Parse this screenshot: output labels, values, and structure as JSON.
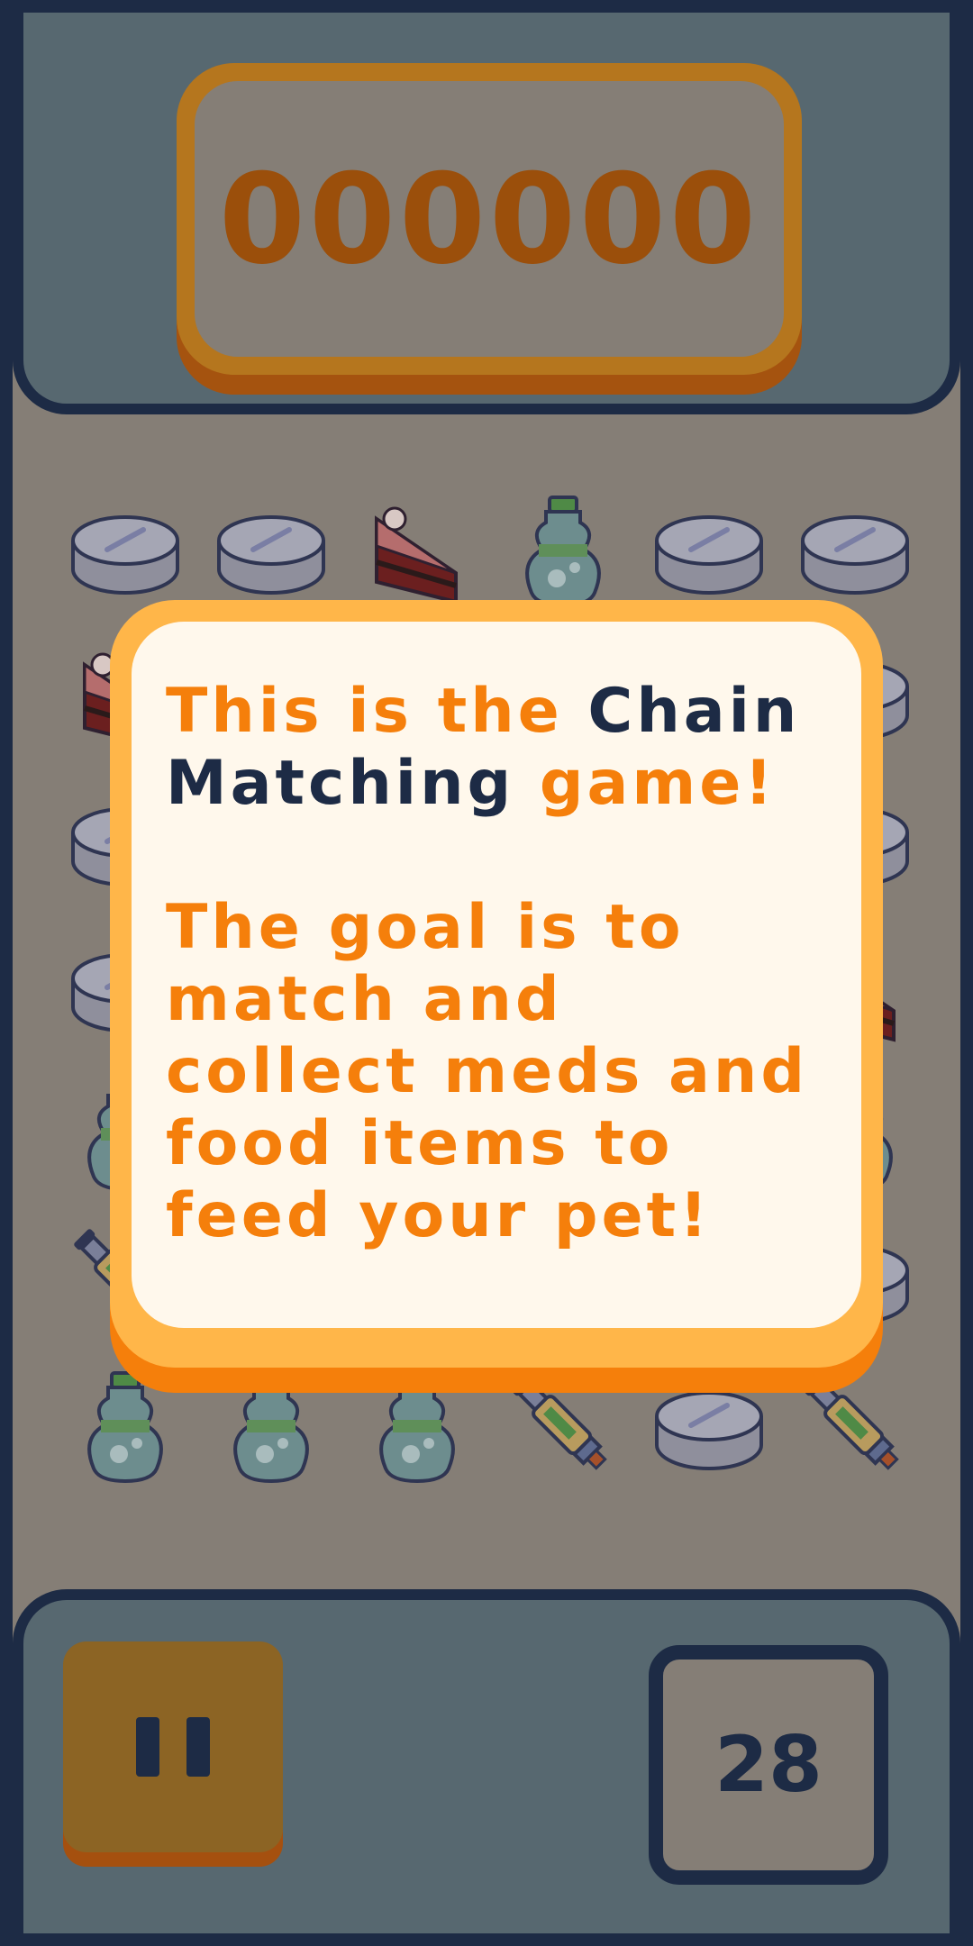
{
  "score": {
    "value": "000000"
  },
  "dialog": {
    "line1_a": "This is the ",
    "line1_b": "Chain",
    "line2_a": "Matching",
    "line2_b": " game!",
    "paragraph2": "The goal is to match and collect meds and food items to feed your pet!"
  },
  "controls": {
    "pause_icon": "pause-icon",
    "moves_left": "28"
  },
  "board": {
    "rows": [
      [
        "pill",
        "pill",
        "cake",
        "bottle",
        "pill",
        "pill"
      ],
      [
        "cake",
        "hidden",
        "hidden",
        "hidden",
        "hidden",
        "pill"
      ],
      [
        "pill",
        "hidden",
        "hidden",
        "hidden",
        "hidden",
        "pill"
      ],
      [
        "pill",
        "hidden",
        "hidden",
        "hidden",
        "hidden",
        "cake"
      ],
      [
        "bottle",
        "hidden",
        "hidden",
        "hidden",
        "hidden",
        "bottle"
      ],
      [
        "injector",
        "hidden",
        "hidden",
        "hidden",
        "hidden",
        "pill"
      ],
      [
        "bottle",
        "bottle",
        "bottle",
        "injector",
        "pill",
        "injector"
      ]
    ]
  },
  "colors": {
    "background": "#857e76",
    "frame": "#1d2b45",
    "accent_orange": "#f57f0b",
    "dialog_bg": "#fff8ec"
  }
}
